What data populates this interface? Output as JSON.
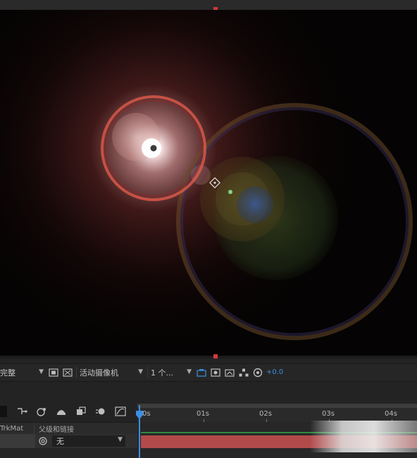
{
  "viewer_toolbar": {
    "resolution": "完整",
    "view": "活动摄像机",
    "layout": "1 个...",
    "exposure": "+0.0"
  },
  "timeline": {
    "columns": {
      "trkmat": "TrkMat",
      "parent": "父级和链接"
    },
    "layer": {
      "parent_value": "无"
    },
    "ruler": [
      "0s",
      "01s",
      "02s",
      "03s",
      "04s"
    ]
  },
  "colors": {
    "accent": "#3d8fe0",
    "anchor": "#d23a3a",
    "track_red": "#b24a4a",
    "track_green": "#2f8a3f"
  },
  "icons": [
    "chevron-down-icon",
    "region-of-interest-icon",
    "transparency-grid-icon",
    "camera-icon",
    "snapshot-icon",
    "channel-icon",
    "color-management-icon",
    "comp-flowchart-icon",
    "draft-3d-icon",
    "motion-blur-icon",
    "graph-editor-icon",
    "pickwhip-icon"
  ]
}
